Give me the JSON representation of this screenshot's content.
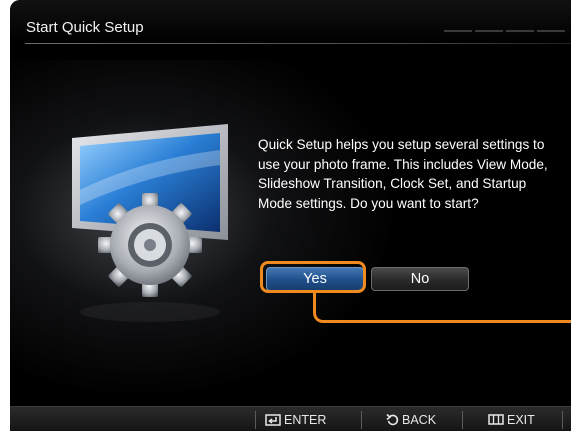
{
  "header": {
    "title": "Start Quick Setup",
    "step_count": 4
  },
  "dialog": {
    "message": "Quick Setup helps you setup several settings to use your photo frame. This includes View Mode, Slideshow Transition, Clock Set, and Startup Mode settings. Do you want to start?",
    "yes_label": "Yes",
    "no_label": "No",
    "focused_button": "Yes"
  },
  "footer": {
    "enter_label": "ENTER",
    "back_label": "BACK",
    "exit_label": "EXIT"
  },
  "icons": {
    "illustration": "monitor-with-gear-icon",
    "enter": "enter-icon",
    "back": "back-arrow-icon",
    "exit": "exit-icon"
  },
  "colors": {
    "background": "#000000",
    "focus_highlight": "#f08a1e",
    "selected_button": "#2a5c98",
    "text": "#ffffff"
  }
}
